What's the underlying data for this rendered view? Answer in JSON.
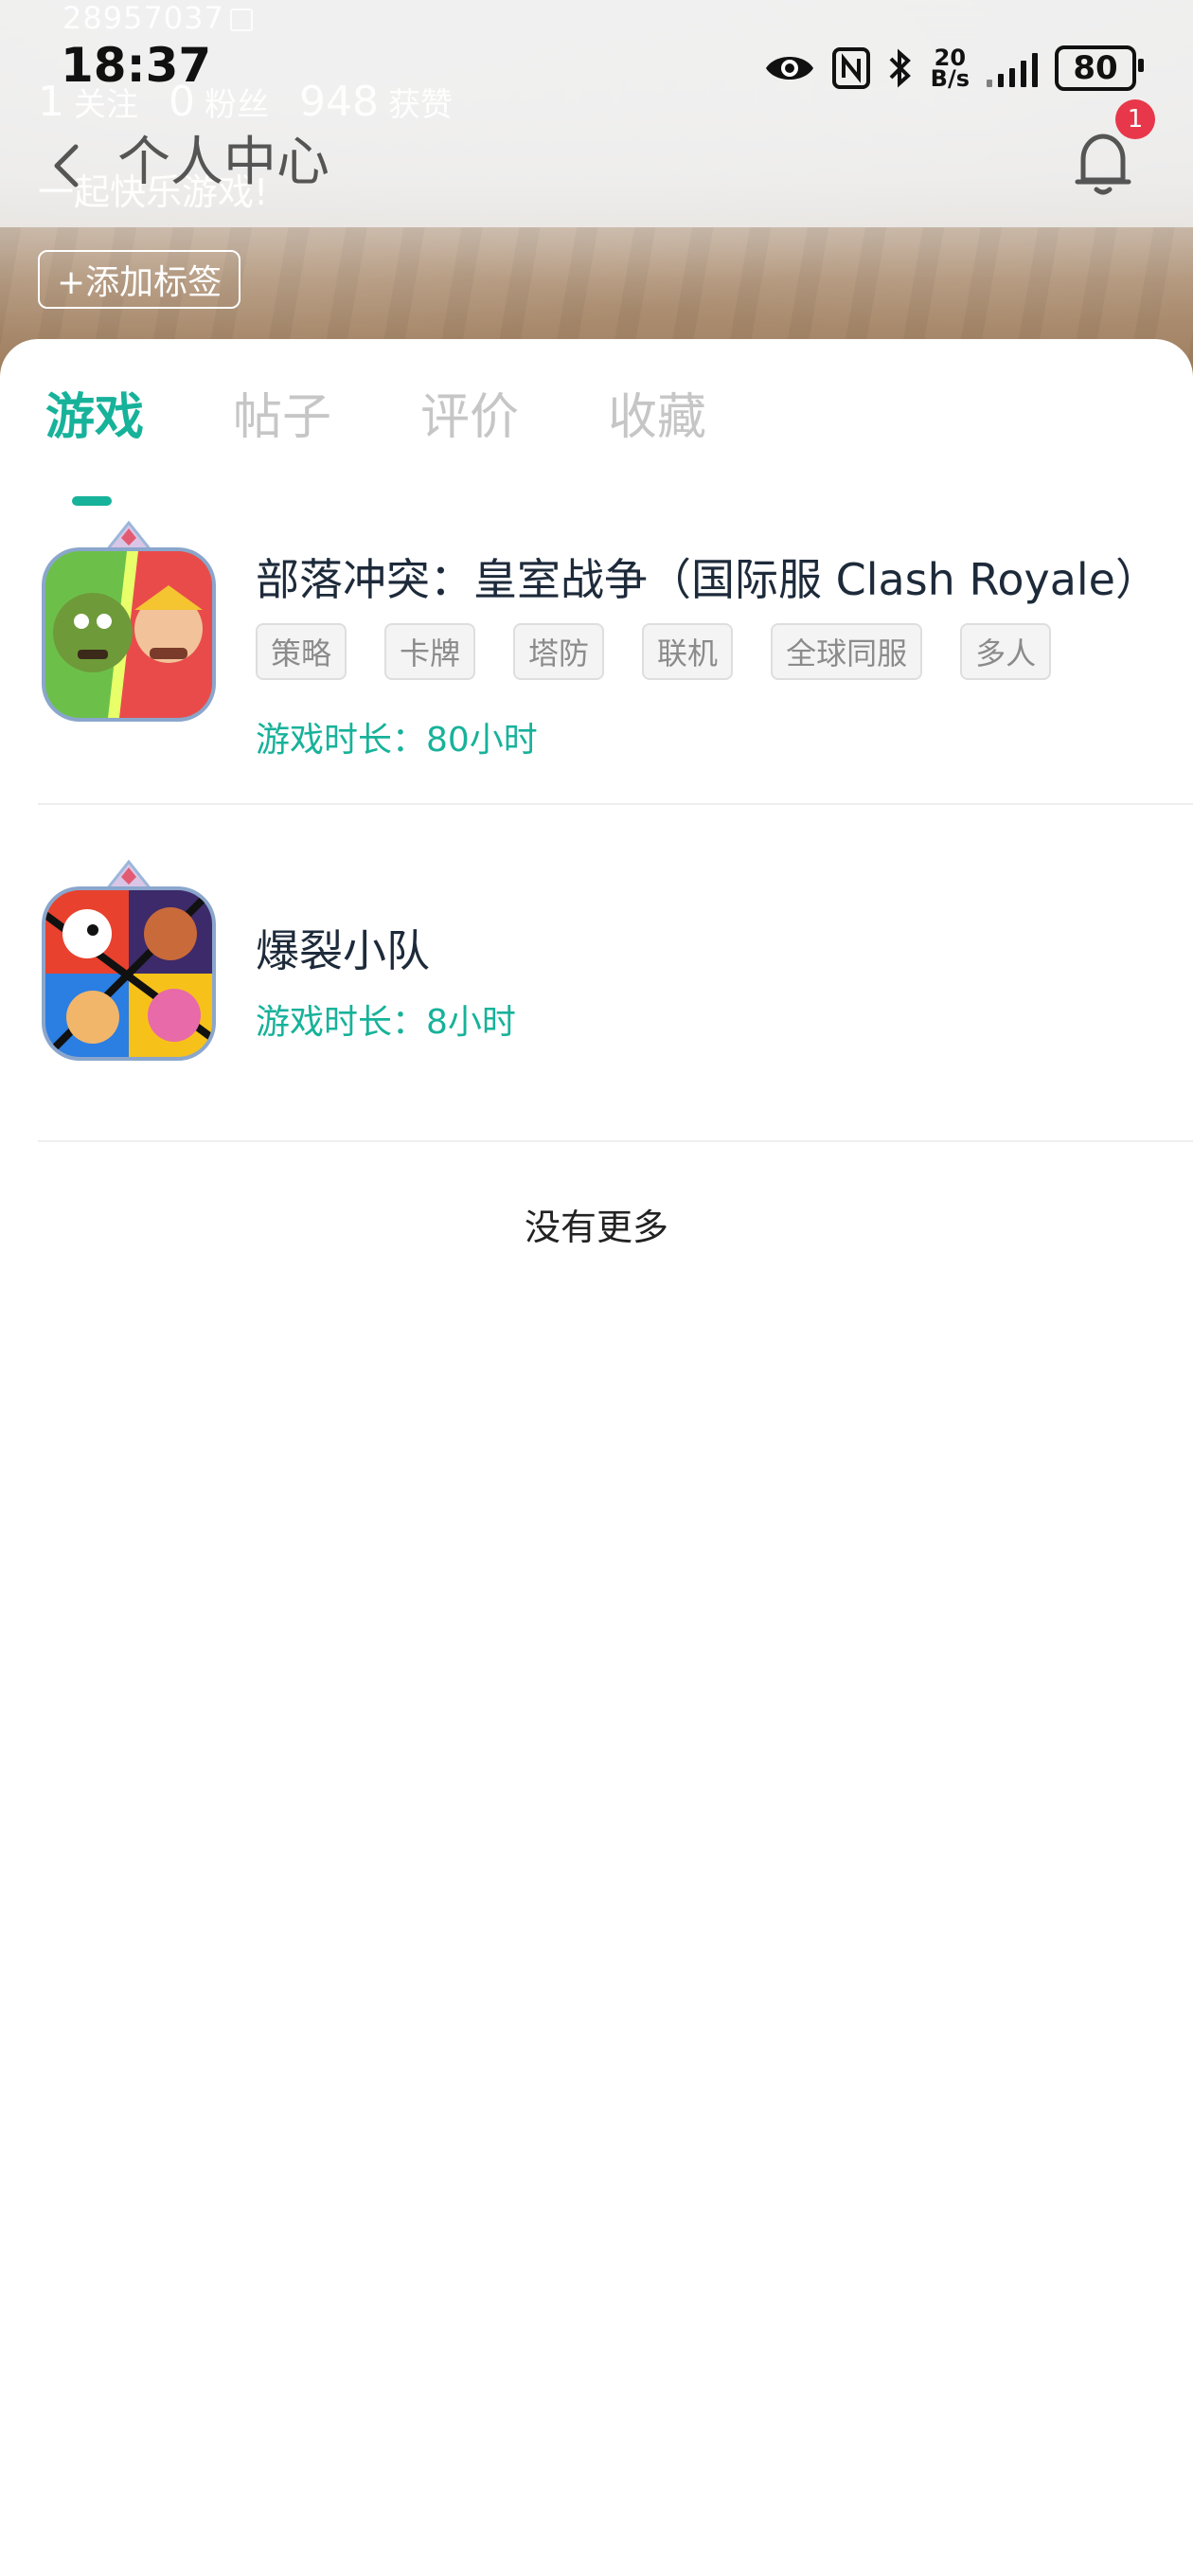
{
  "status_bar": {
    "uid": "28957037",
    "time": "18:37",
    "net_speed_value": "20",
    "net_speed_unit": "B/s",
    "battery": "80"
  },
  "header": {
    "back_label": "‹",
    "title": "个人中心",
    "notification_count": "1",
    "stats": {
      "following_count": "1",
      "following_label": "关注",
      "followers_count": "0",
      "followers_label": "粉丝",
      "likes_count": "948",
      "likes_label": "获赞"
    },
    "bio": "一起快乐游戏!",
    "add_tag_label": "+添加标签"
  },
  "tabs": [
    {
      "label": "游戏",
      "active": true
    },
    {
      "label": "帖子",
      "active": false
    },
    {
      "label": "评价",
      "active": false
    },
    {
      "label": "收藏",
      "active": false
    }
  ],
  "games": [
    {
      "name": "部落冲突：皇室战争（国际服 Clash Royale）",
      "tags": [
        "策略",
        "卡牌",
        "塔防",
        "联机",
        "全球同服",
        "多人"
      ],
      "playtime": "游戏时长：80小时",
      "icon": "clash-royale-icon"
    },
    {
      "name": "爆裂小队",
      "tags": [],
      "playtime": "游戏时长：8小时",
      "icon": "squad-busters-icon"
    }
  ],
  "footer": {
    "no_more": "没有更多"
  },
  "colors": {
    "accent": "#17b29a",
    "badge": "#e8374a"
  }
}
